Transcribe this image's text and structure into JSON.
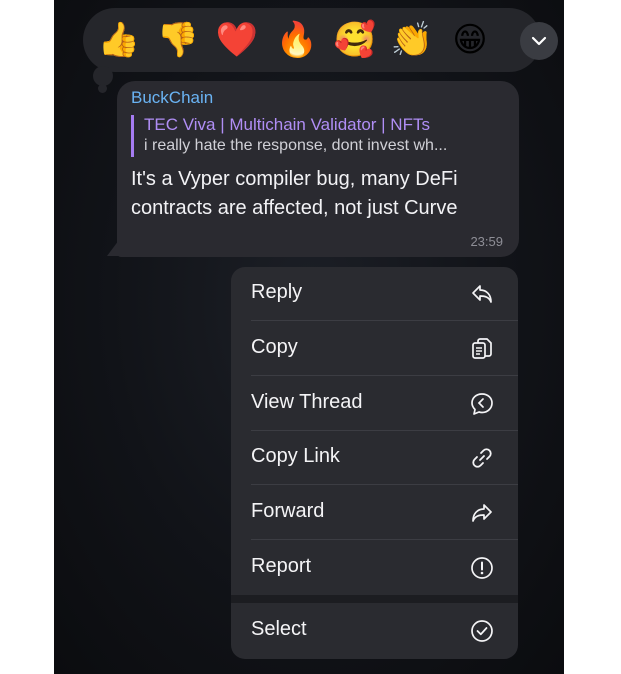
{
  "reactions": [
    {
      "emoji": "👍",
      "icon": "thumbs-up-icon"
    },
    {
      "emoji": "👎",
      "icon": "thumbs-down-icon"
    },
    {
      "emoji": "❤️",
      "icon": "heart-icon"
    },
    {
      "emoji": "🔥",
      "icon": "fire-icon"
    },
    {
      "emoji": "🥰",
      "icon": "smiling-hearts-icon"
    },
    {
      "emoji": "👏",
      "icon": "clapping-hands-icon"
    },
    {
      "emoji": "😁",
      "icon": "grinning-face-icon"
    }
  ],
  "message": {
    "sender": "BuckChain",
    "quote_title": "TEC Viva | Multichain Validator | NFTs",
    "quote_text": "i really hate the response, dont invest wh...",
    "text": "It's a Vyper compiler bug, many DeFi contracts are affected, not just Curve",
    "time": "23:59"
  },
  "menu": {
    "items": [
      {
        "label": "Reply",
        "icon": "reply-icon"
      },
      {
        "label": "Copy",
        "icon": "copy-icon"
      },
      {
        "label": "View Thread",
        "icon": "thread-icon"
      },
      {
        "label": "Copy Link",
        "icon": "link-icon"
      },
      {
        "label": "Forward",
        "icon": "forward-icon"
      },
      {
        "label": "Report",
        "icon": "report-icon"
      }
    ],
    "select_label": "Select"
  },
  "colors": {
    "accent_sender": "#6ab3f3",
    "quote_accent": "#a67cf2",
    "bubble": "#2a2a30",
    "menu": "#2a2b30"
  }
}
